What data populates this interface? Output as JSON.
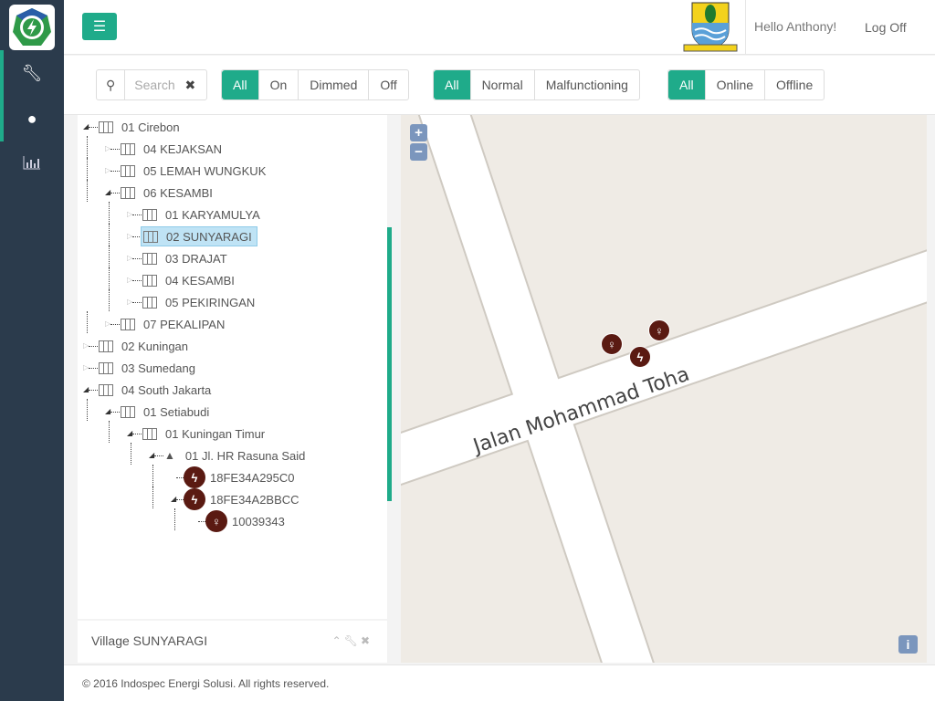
{
  "header": {
    "greeting": "Hello Anthony!",
    "logoff": "Log Off"
  },
  "sidebar": {
    "items": [
      {
        "icon": "wrench-icon"
      },
      {
        "icon": "globe-icon",
        "active": true
      },
      {
        "icon": "bar-chart-icon"
      }
    ]
  },
  "search": {
    "placeholder": "Search"
  },
  "filters": {
    "dimming": {
      "options": [
        "All",
        "On",
        "Dimmed",
        "Off"
      ],
      "selected": "All"
    },
    "health": {
      "options": [
        "All",
        "Normal",
        "Malfunctioning"
      ],
      "selected": "All"
    },
    "connectivity": {
      "options": [
        "All",
        "Online",
        "Offline"
      ],
      "selected": "All"
    }
  },
  "tree": [
    {
      "label": "01 Cirebon",
      "level": 0,
      "toggle": "expanded",
      "icon": "map"
    },
    {
      "label": "04 KEJAKSAN",
      "level": 1,
      "toggle": "collapsed",
      "icon": "map"
    },
    {
      "label": "05 LEMAH WUNGKUK",
      "level": 1,
      "toggle": "collapsed",
      "icon": "map"
    },
    {
      "label": "06 KESAMBI",
      "level": 1,
      "toggle": "expanded",
      "icon": "map"
    },
    {
      "label": "01 KARYAMULYA",
      "level": 2,
      "toggle": "collapsed",
      "icon": "map"
    },
    {
      "label": "02 SUNYARAGI",
      "level": 2,
      "toggle": "collapsed",
      "icon": "map",
      "selected": true
    },
    {
      "label": "03 DRAJAT",
      "level": 2,
      "toggle": "collapsed",
      "icon": "map"
    },
    {
      "label": "04 KESAMBI",
      "level": 2,
      "toggle": "collapsed",
      "icon": "map"
    },
    {
      "label": "05 PEKIRINGAN",
      "level": 2,
      "toggle": "collapsed",
      "icon": "map"
    },
    {
      "label": "07 PEKALIPAN",
      "level": 1,
      "toggle": "collapsed",
      "icon": "map"
    },
    {
      "label": "02 Kuningan",
      "level": 0,
      "toggle": "collapsed",
      "icon": "map"
    },
    {
      "label": "03 Sumedang",
      "level": 0,
      "toggle": "collapsed",
      "icon": "map"
    },
    {
      "label": "04 South Jakarta",
      "level": 0,
      "toggle": "expanded",
      "icon": "map"
    },
    {
      "label": "01 Setiabudi",
      "level": 1,
      "toggle": "expanded",
      "icon": "map"
    },
    {
      "label": "01 Kuningan Timur",
      "level": 2,
      "toggle": "expanded",
      "icon": "map"
    },
    {
      "label": "01 Jl. HR Rasuna Said",
      "level": 3,
      "toggle": "expanded",
      "icon": "road"
    },
    {
      "label": "18FE34A295C0",
      "level": 4,
      "toggle": "none",
      "icon": "bolt"
    },
    {
      "label": "18FE34A2BBCC",
      "level": 4,
      "toggle": "expanded",
      "icon": "bolt"
    },
    {
      "label": "10039343",
      "level": 5,
      "toggle": "none",
      "icon": "bulb"
    }
  ],
  "panel": {
    "title": "Village SUNYARAGI"
  },
  "map": {
    "street": "Jalan Mohammad Toha",
    "zoom_in": "+",
    "zoom_out": "−",
    "info": "i",
    "markers": [
      {
        "icon": "bulb"
      },
      {
        "icon": "bulb"
      },
      {
        "icon": "bolt"
      }
    ]
  },
  "footer": {
    "copyright": "© 2016 Indospec Energi Solusi. All rights reserved."
  },
  "colors": {
    "accent": "#1fab8a",
    "sidebar": "#2b3b4c",
    "device": "#5a1a12",
    "map_control": "#7b96bd"
  }
}
